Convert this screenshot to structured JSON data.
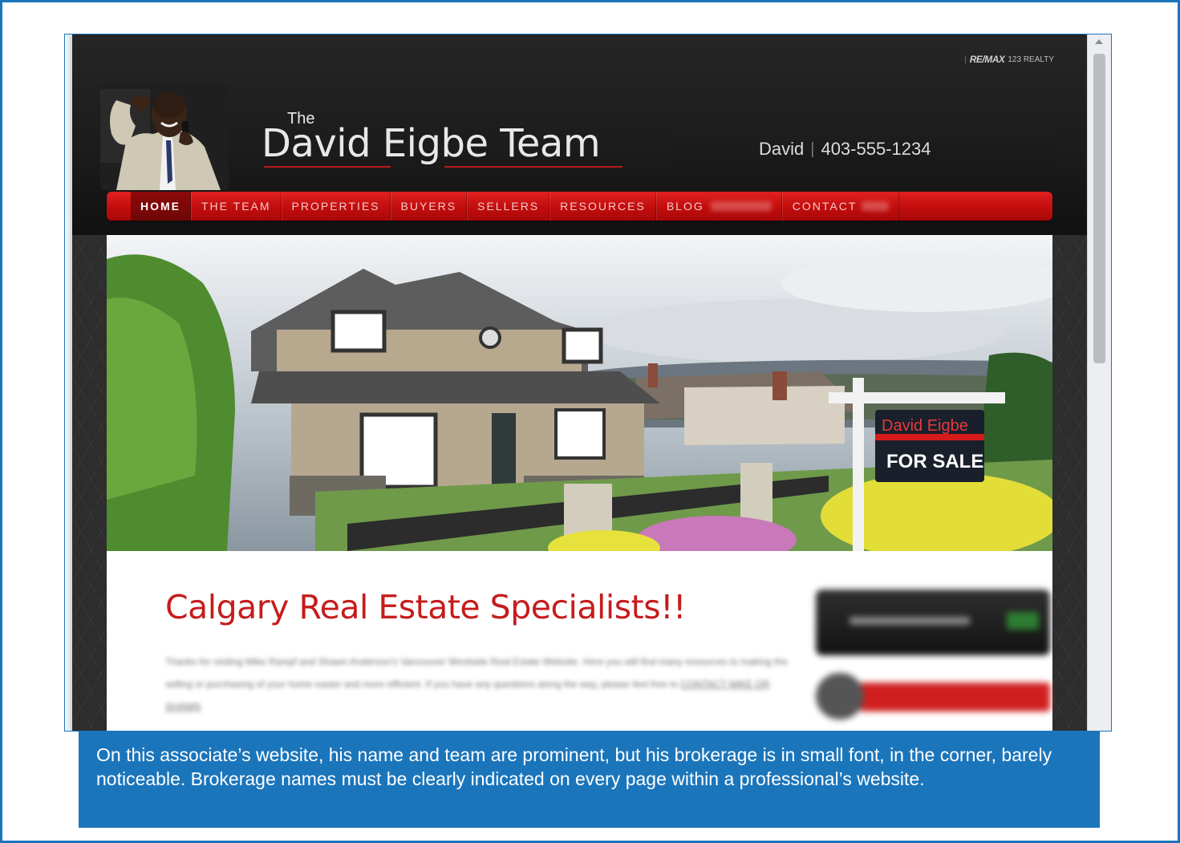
{
  "page": {
    "caption": "On this associate’s website, his name and team are prominent, but his brokerage is in small font, in the corner, barely noticeable. Brokerage names must be clearly indicated on every page within a professional’s website."
  },
  "site": {
    "brokerage": {
      "separator": "|",
      "logo_text": "RE/MAX",
      "name": "123 REALTY"
    },
    "title": {
      "prefix": "The",
      "main": "David Eigbe Team"
    },
    "contact": {
      "name": "David",
      "separator": "|",
      "phone": "403-555-1234"
    },
    "nav": [
      {
        "label": "HOME",
        "active": true
      },
      {
        "label": "THE TEAM",
        "active": false
      },
      {
        "label": "PROPERTIES",
        "active": false
      },
      {
        "label": "BUYERS",
        "active": false
      },
      {
        "label": "SELLERS",
        "active": false
      },
      {
        "label": "RESOURCES",
        "active": false
      },
      {
        "label": "BLOG",
        "active": false
      },
      {
        "label": "CONTACT",
        "active": false
      }
    ],
    "hero": {
      "sign_name": "David Eigbe",
      "sign_status": "FOR SALE"
    },
    "headline": "Calgary Real Estate Specialists!!",
    "intro_blurred": {
      "text": "Thanks for visiting Mike Rampf and Shawn Anderson's Vancouver Westside Real Estate Website. Here you will find many resources to making the selling or purchasing of your home easier and more efficient. If you have any questions along the way, please feel free to",
      "link": "CONTACT MIKE OR SHAWN"
    }
  },
  "colors": {
    "frame_blue": "#1b75bb",
    "nav_red": "#c20d0d",
    "headline_red": "#c51c1c",
    "header_dark": "#1b1b1b"
  }
}
